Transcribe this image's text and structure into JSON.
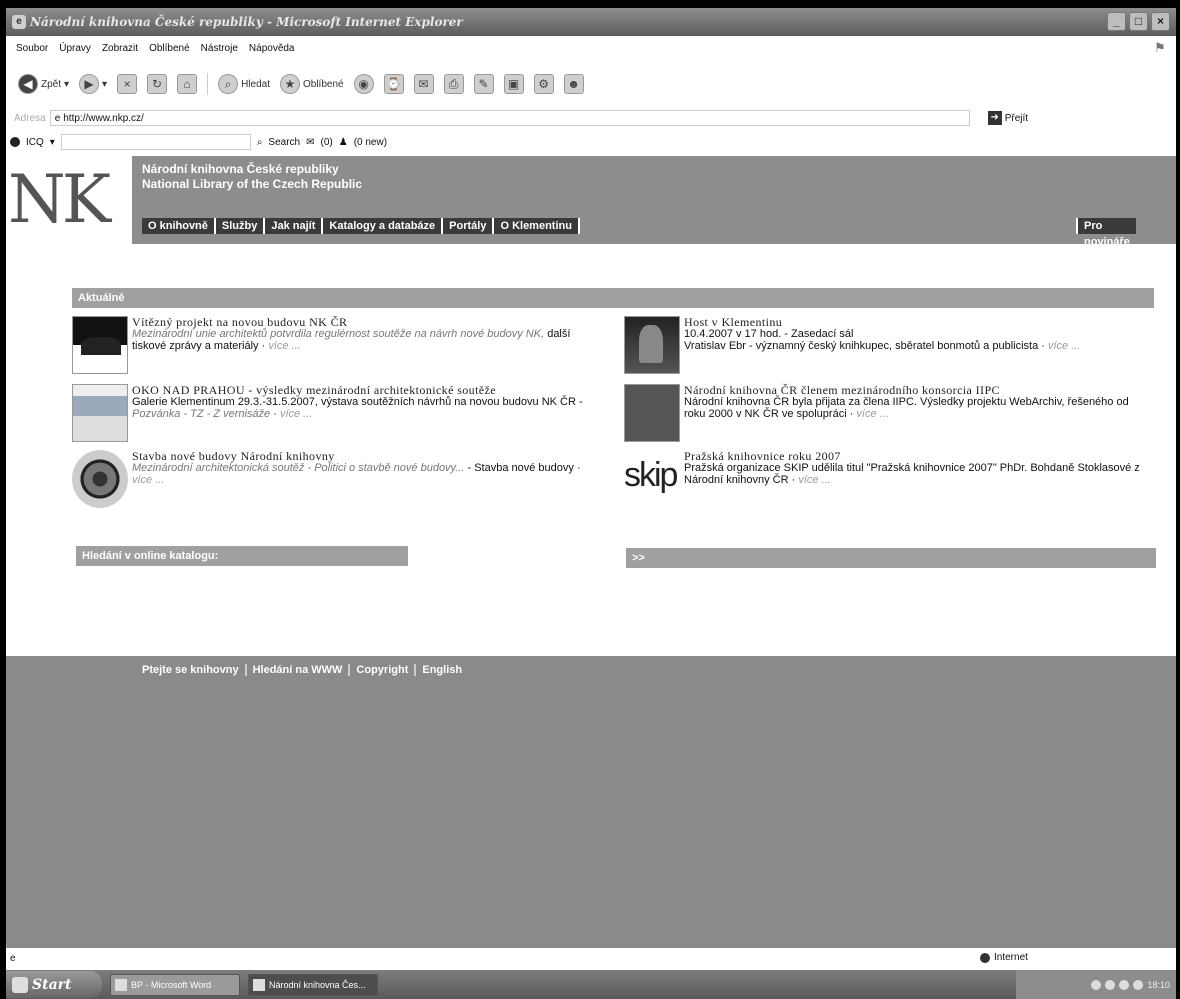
{
  "window": {
    "title": "Národní knihovna České republiky - Microsoft Internet Explorer",
    "controls": [
      "_",
      "□",
      "×"
    ]
  },
  "menu": [
    "Soubor",
    "Úpravy",
    "Zobrazit",
    "Oblíbené",
    "Nástroje",
    "Nápověda"
  ],
  "toolbar": {
    "back": "Zpět",
    "search": "Hledat",
    "favorites": "Oblíbené"
  },
  "address": {
    "label": "Adresa",
    "url": "http://www.nkp.cz/",
    "go": "Přejít"
  },
  "icq": {
    "label": "ICQ",
    "search": "Search",
    "messages": "(0)",
    "mail": "(0 new)"
  },
  "site": {
    "logo": "NK",
    "name_cz": "Národní knihovna České republiky",
    "name_en": "National Library of the Czech Republic",
    "nav": [
      "O knihovně",
      "Služby",
      "Jak najít",
      "Katalogy a databáze",
      "Portály",
      "O Klementinu"
    ],
    "nav_right": "Pro novináře",
    "news_header": "Aktuálně",
    "news_left": [
      {
        "title": "Vítězný projekt na novou budovu NK ČR",
        "italic": "Mezinárodní unie architektů potvrdila regulérnost soutěže na návrh nové budovy NK,",
        "text": " další tiskové zprávy a materiály",
        "more": "více ..."
      },
      {
        "title": "OKO NAD PRAHOU - výsledky mezinárodní architektonické soutěže",
        "text": "Galerie Klementinum 29.3.-31.5.2007, výstava soutěžních návrhů na novou budovu NK ČR - ",
        "italic": "Pozvánka - TZ - Z vernisáže",
        "more": "více ..."
      },
      {
        "title": "Stavba nové budovy Národní knihovny",
        "italic": "Mezinárodní architektonická soutěž - Politici o stavbě nové budovy...",
        "text": " - Stavba nové budovy",
        "more": "více ..."
      }
    ],
    "news_right": [
      {
        "title": "Host v Klementinu",
        "line1": "10.4.2007 v 17 hod. - Zasedací sál",
        "text": "Vratislav Ebr - významný český knihkupec, sběratel bonmotů a publicista",
        "more": "více ..."
      },
      {
        "title": "Národní knihovna ČR členem mezinárodního konsorcia IIPC",
        "text": "Národní knihovna ČR byla přijata za člena IIPC. Výsledky projektu WebArchiv, řešeného od roku 2000 v NK ČR ve spolupráci",
        "more": "více ..."
      },
      {
        "title": "Pražská knihovnice roku 2007",
        "text": "Pražská organizace SKIP udělila titul \"Pražská knihovnice 2007\" PhDr. Bohdaně Stoklasové z Národní knihovny ČR",
        "more": "více ..."
      }
    ],
    "thumb_skip": "skip",
    "search_header": "Hledání v online katalogu:",
    "right_header": ">>",
    "footer_links": [
      "Ptejte se knihovny",
      "Hledání na WWW",
      "Copyright",
      "English"
    ]
  },
  "status": {
    "zone": "Internet"
  },
  "taskbar": {
    "start": "Start",
    "items": [
      "BP - Microsoft Word",
      "Národní knihovna Čes..."
    ],
    "clock": "18:10"
  }
}
